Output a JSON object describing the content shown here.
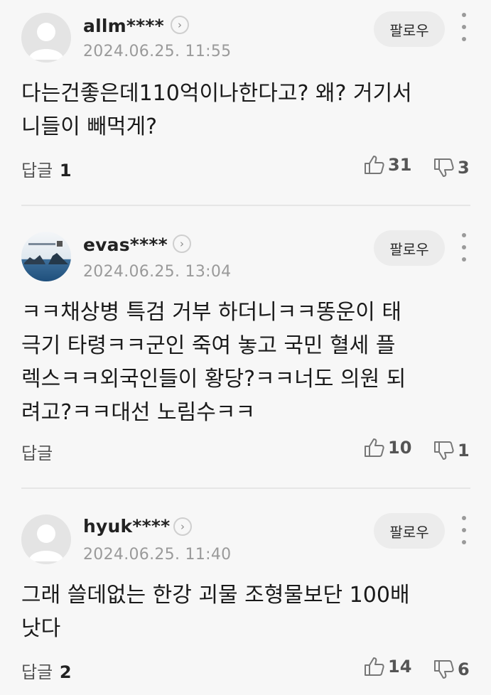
{
  "comments": [
    {
      "username": "allm****",
      "timestamp": "2024.06.25. 11:55",
      "follow_label": "팔로우",
      "text": "다는건좋은데110억이나한다고? 왜? 거기서\n니들이 빼먹게?",
      "reply_label": "답글",
      "reply_count": "1",
      "likes": "31",
      "dislikes": "3",
      "avatar": "default-avatar"
    },
    {
      "username": "evas****",
      "timestamp": "2024.06.25. 13:04",
      "follow_label": "팔로우",
      "text": "ㅋㅋ채상병 특검 거부 하더니ㅋㅋ똥운이 태\n극기 타령ㅋㅋ군인 죽여 놓고 국민 혈세 플\n렉스ㅋㅋ외국인들이 황당?ㅋㅋ너도 의원 되\n려고?ㅋㅋ대선 노림수ㅋㅋ",
      "reply_label": "답글",
      "reply_count": "",
      "likes": "10",
      "dislikes": "1",
      "avatar": "island-photo-avatar"
    },
    {
      "username": "hyuk****",
      "timestamp": "2024.06.25. 11:40",
      "follow_label": "팔로우",
      "text": "그래 쓸데없는 한강 괴물 조형물보단 100배\n낫다",
      "reply_label": "답글",
      "reply_count": "2",
      "likes": "14",
      "dislikes": "6",
      "avatar": "default-avatar"
    }
  ]
}
